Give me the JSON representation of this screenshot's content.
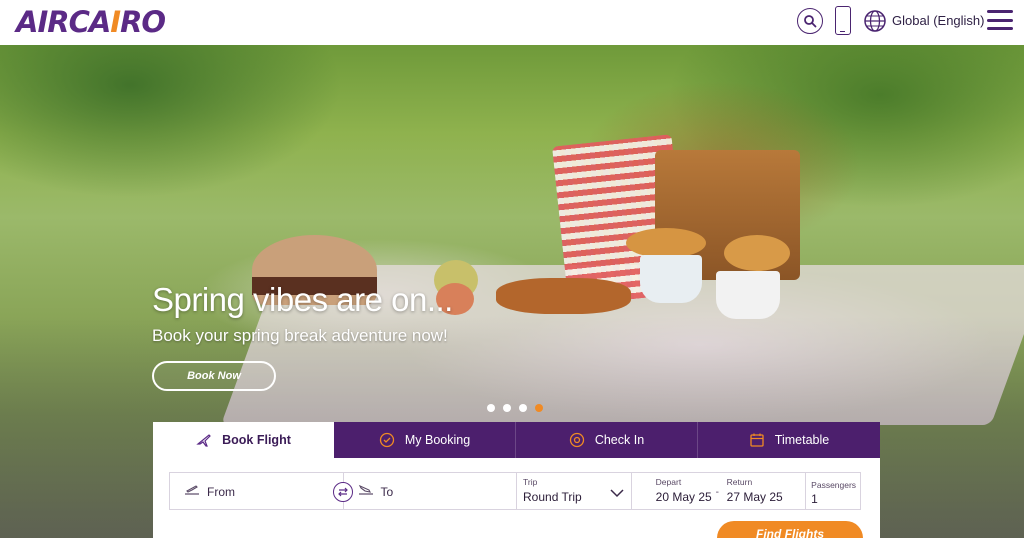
{
  "header": {
    "logo_text_1": "AIRCA",
    "logo_text_2": "I",
    "logo_text_3": "RO",
    "language_label": "Global (English)"
  },
  "hero": {
    "title": "Spring vibes are on...",
    "subtitle": "Book your spring break adventure now!",
    "cta_label": "Book Now",
    "slides": 4,
    "active_slide": 4
  },
  "booking": {
    "tabs": [
      {
        "label": "Book Flight",
        "icon": "plane-icon",
        "active": true
      },
      {
        "label": "My Booking",
        "icon": "booking-icon",
        "active": false
      },
      {
        "label": "Check In",
        "icon": "check-in-icon",
        "active": false
      },
      {
        "label": "Timetable",
        "icon": "calendar-icon",
        "active": false
      }
    ],
    "from_label": "From",
    "to_label": "To",
    "trip_caption": "Trip",
    "trip_value": "Round Trip",
    "depart_caption": "Depart",
    "depart_value": "20 May 25",
    "return_caption": "Return",
    "return_value": "27 May 25",
    "passengers_caption": "Passengers",
    "passengers_value": "1",
    "find_label": "Find Flights"
  },
  "colors": {
    "brand_purple": "#4c1f6d",
    "brand_orange": "#f08a24"
  }
}
